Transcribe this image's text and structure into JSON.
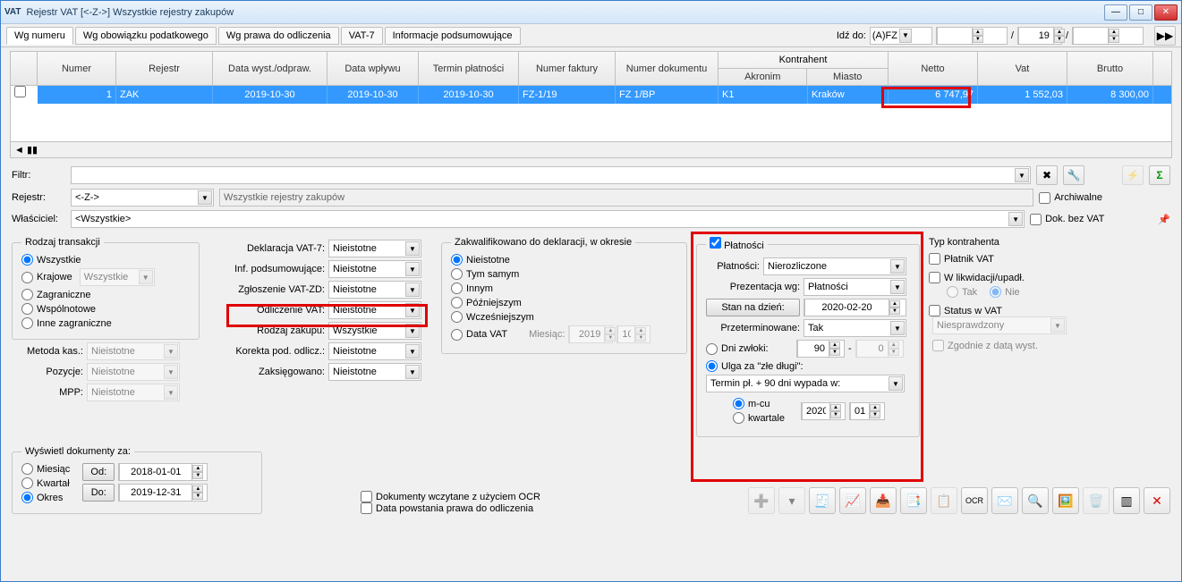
{
  "title": "Rejestr VAT   [<-Z->]   Wszystkie rejestry zakupów",
  "tabs": [
    "Wg numeru",
    "Wg obowiązku podatkowego",
    "Wg prawa do odliczenia",
    "VAT-7",
    "Informacje podsumowujące"
  ],
  "goto": {
    "label": "Idź do:",
    "select": "(A)FZ",
    "num": "19"
  },
  "grid": {
    "headers": {
      "numer": "Numer",
      "rejestr": "Rejestr",
      "data_wyst": "Data wyst./odpraw.",
      "data_wplywu": "Data wpływu",
      "termin": "Termin płatności",
      "nr_faktury": "Numer faktury",
      "nr_dokumentu": "Numer dokumentu",
      "kontrahent": "Kontrahent",
      "akronim": "Akronim",
      "miasto": "Miasto",
      "netto": "Netto",
      "vat": "Vat",
      "brutto": "Brutto"
    },
    "row": {
      "numer": "1",
      "rejestr": "ZAK",
      "data_wyst": "2019-10-30",
      "data_wplywu": "2019-10-30",
      "termin": "2019-10-30",
      "nr_faktury": "FZ-1/19",
      "nr_dokumentu": "FZ 1/BP",
      "akronim": "K1",
      "miasto": "Kraków",
      "netto": "6 747,97",
      "vat": "1 552,03",
      "brutto": "8 300,00"
    }
  },
  "filters": {
    "filtr": "Filtr:",
    "rejestr": "Rejestr:",
    "rejestr_val": "<-Z->",
    "rejestr_desc": "Wszystkie rejestry zakupów",
    "wlasciciel": "Właściciel:",
    "wlasciciel_val": "<Wszystkie>",
    "archiwalne": "Archiwalne",
    "dok_bez_vat": "Dok. bez VAT"
  },
  "rodzaj_trans": {
    "title": "Rodzaj transakcji",
    "wszystkie": "Wszystkie",
    "krajowe": "Krajowe",
    "krajowe_val": "Wszystkie",
    "zagraniczne": "Zagraniczne",
    "wspolnotowe": "Wspólnotowe",
    "inne": "Inne zagraniczne",
    "metoda": "Metoda kas.:",
    "metoda_val": "Nieistotne",
    "pozycje": "Pozycje:",
    "pozycje_val": "Nieistotne",
    "mpp": "MPP:",
    "mpp_val": "Nieistotne"
  },
  "deklaracja": {
    "vat7": "Deklaracja VAT-7:",
    "vat7_val": "Nieistotne",
    "inf": "Inf. podsumowujące:",
    "inf_val": "Nieistotne",
    "zgl": "Zgłoszenie VAT-ZD:",
    "zgl_val": "Nieistotne",
    "odl": "Odliczenie VAT:",
    "odl_val": "Nieistotne",
    "rodzaj": "Rodzaj zakupu:",
    "rodzaj_val": "Wszystkie",
    "korekta": "Korekta pod. odlicz.:",
    "korekta_val": "Nieistotne",
    "zaks": "Zaksięgowano:",
    "zaks_val": "Nieistotne"
  },
  "zakwal": {
    "title": "Zakwalifikowano do deklaracji, w okresie",
    "nieistotne": "Nieistotne",
    "tym": "Tym samym",
    "innym": "Innym",
    "pozniej": "Późniejszym",
    "wczesniej": "Wcześniejszym",
    "datavat": "Data VAT",
    "miesiac": "Miesiąc:",
    "rok": "2019",
    "m": "10"
  },
  "platnosci": {
    "title": "Płatności",
    "platnosci": "Płatności:",
    "platnosci_val": "Nierozliczone",
    "prez": "Prezentacja wg:",
    "prez_val": "Płatności",
    "stan": "Stan na dzień:",
    "stan_val": "2020-02-20",
    "przet": "Przeterminowane:",
    "przet_val": "Tak",
    "dni": "Dni zwłoki:",
    "dni_od": "90",
    "dni_do": "0",
    "ulga": "Ulga za \"złe długi\":",
    "termin": "Termin pł. + 90 dni wypada w:",
    "mcu": "m-cu",
    "kwartale": "kwartale",
    "rok": "2020",
    "mies": "01"
  },
  "typ": {
    "title": "Typ kontrahenta",
    "platnik": "Płatnik VAT",
    "likw": "W likwidacji/upadł.",
    "tak": "Tak",
    "nie": "Nie",
    "status": "Status w VAT",
    "status_val": "Niesprawdzony",
    "zgodnie": "Zgodnie z datą wyst."
  },
  "wyswietl": {
    "title": "Wyświetl dokumenty za:",
    "miesiac": "Miesiąc",
    "kwartal": "Kwartał",
    "okres": "Okres",
    "od": "Od:",
    "od_val": "2018-01-01",
    "do": "Do:",
    "do_val": "2019-12-31"
  },
  "ocr": {
    "wczytane": "Dokumenty wczytane z użyciem OCR",
    "data_pow": "Data powstania prawa do odliczenia"
  }
}
